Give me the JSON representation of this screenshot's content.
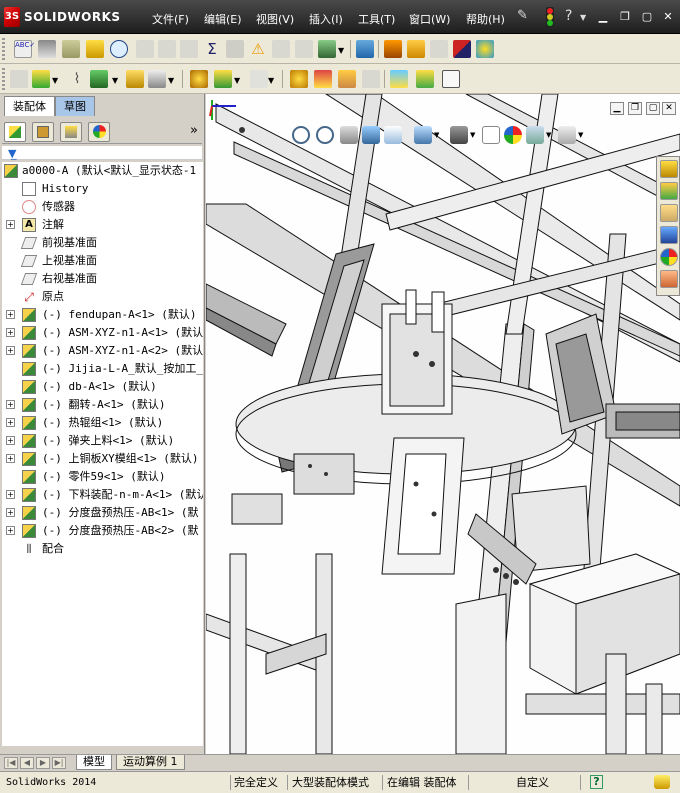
{
  "app": {
    "logo_text": "SOLIDWORKS",
    "brand_color": "#cc0000"
  },
  "menu": {
    "items": [
      "文件(F)",
      "编辑(E)",
      "视图(V)",
      "插入(I)",
      "工具(T)",
      "窗口(W)",
      "帮助(H)"
    ]
  },
  "titlebar_icons": [
    "pin-icon",
    "traffic-light-icon",
    "help-icon",
    "minimize-icon",
    "restore-icon",
    "close-icon"
  ],
  "panel": {
    "tabs": [
      "装配体",
      "草图"
    ],
    "more_label": "»"
  },
  "tree": {
    "root": "a0000-A (默认<默认_显示状态-1",
    "nodes": [
      {
        "label": "History",
        "icon": "history-icon",
        "expandable": false
      },
      {
        "label": "传感器",
        "icon": "sensor-icon",
        "expandable": false
      },
      {
        "label": "注解",
        "icon": "annotation-icon",
        "expandable": true
      },
      {
        "label": "前视基准面",
        "icon": "plane-icon",
        "expandable": false
      },
      {
        "label": "上视基准面",
        "icon": "plane-icon",
        "expandable": false
      },
      {
        "label": "右视基准面",
        "icon": "plane-icon",
        "expandable": false
      },
      {
        "label": "原点",
        "icon": "origin-icon",
        "expandable": false
      },
      {
        "label": "(-) fendupan-A<1> (默认)",
        "icon": "assembly-icon",
        "expandable": true
      },
      {
        "label": "(-) ASM-XYZ-n1-A<1> (默认)",
        "icon": "assembly-icon",
        "expandable": true
      },
      {
        "label": "(-) ASM-XYZ-n1-A<2> (默认)",
        "icon": "assembly-icon",
        "expandable": true
      },
      {
        "label": "(-) Jijia-L-A_默认_按加工_",
        "icon": "assembly-icon",
        "expandable": false
      },
      {
        "label": "(-) db-A<1> (默认)",
        "icon": "assembly-icon",
        "expandable": false
      },
      {
        "label": "(-) 翻转-A<1> (默认)",
        "icon": "assembly-icon",
        "expandable": true
      },
      {
        "label": "(-) 热辊组<1> (默认)",
        "icon": "assembly-icon",
        "expandable": true
      },
      {
        "label": "(-) 弹夹上料<1> (默认)",
        "icon": "assembly-icon",
        "expandable": true
      },
      {
        "label": "(-) 上铜板XY模组<1> (默认)",
        "icon": "assembly-icon",
        "expandable": true
      },
      {
        "label": "(-) 零件59<1> (默认)",
        "icon": "assembly-icon",
        "expandable": false
      },
      {
        "label": "(-) 下料装配-n-m-A<1> (默认",
        "icon": "assembly-icon",
        "expandable": true
      },
      {
        "label": "(-) 分度盘预热压-AB<1> (默",
        "icon": "assembly-icon",
        "expandable": true
      },
      {
        "label": "(-) 分度盘预热压-AB<2> (默",
        "icon": "assembly-icon",
        "expandable": true
      },
      {
        "label": "配合",
        "icon": "mates-icon",
        "expandable": false
      }
    ]
  },
  "bottom_tabs": [
    "模型",
    "运动算例 1"
  ],
  "status": {
    "app_version": "SolidWorks 2014",
    "constraint": "完全定义",
    "mode": "大型装配体模式",
    "editing": "在编辑 装配体",
    "units": "自定义",
    "help": "?"
  }
}
